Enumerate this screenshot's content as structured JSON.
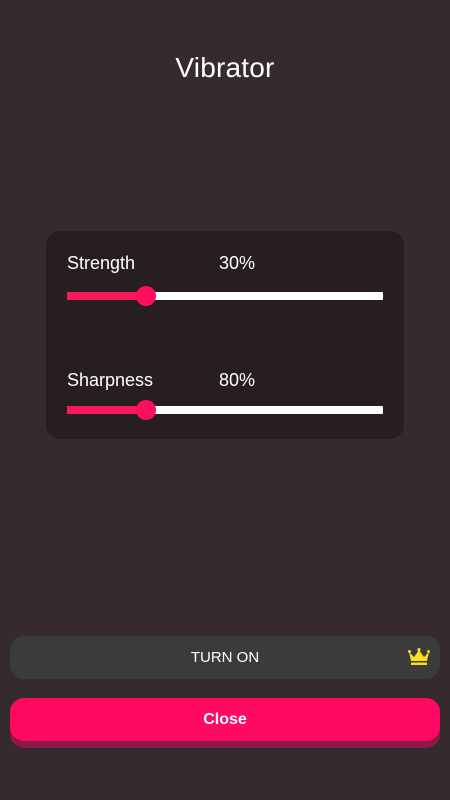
{
  "header": {
    "title": "Vibrator"
  },
  "settings": {
    "strength": {
      "label": "Strength",
      "value_text": "30%",
      "slider_fraction": 0.25
    },
    "sharpness": {
      "label": "Sharpness",
      "value_text": "80%",
      "slider_fraction": 0.25
    }
  },
  "buttons": {
    "turn_on_label": "TURN ON",
    "premium_icon": "crown-icon",
    "close_label": "Close"
  },
  "colors": {
    "background": "#352a2e",
    "card": "#261e21",
    "accent": "#ff0a62",
    "crown": "#f5df1e",
    "turn_on_button": "#3b3b3b"
  }
}
